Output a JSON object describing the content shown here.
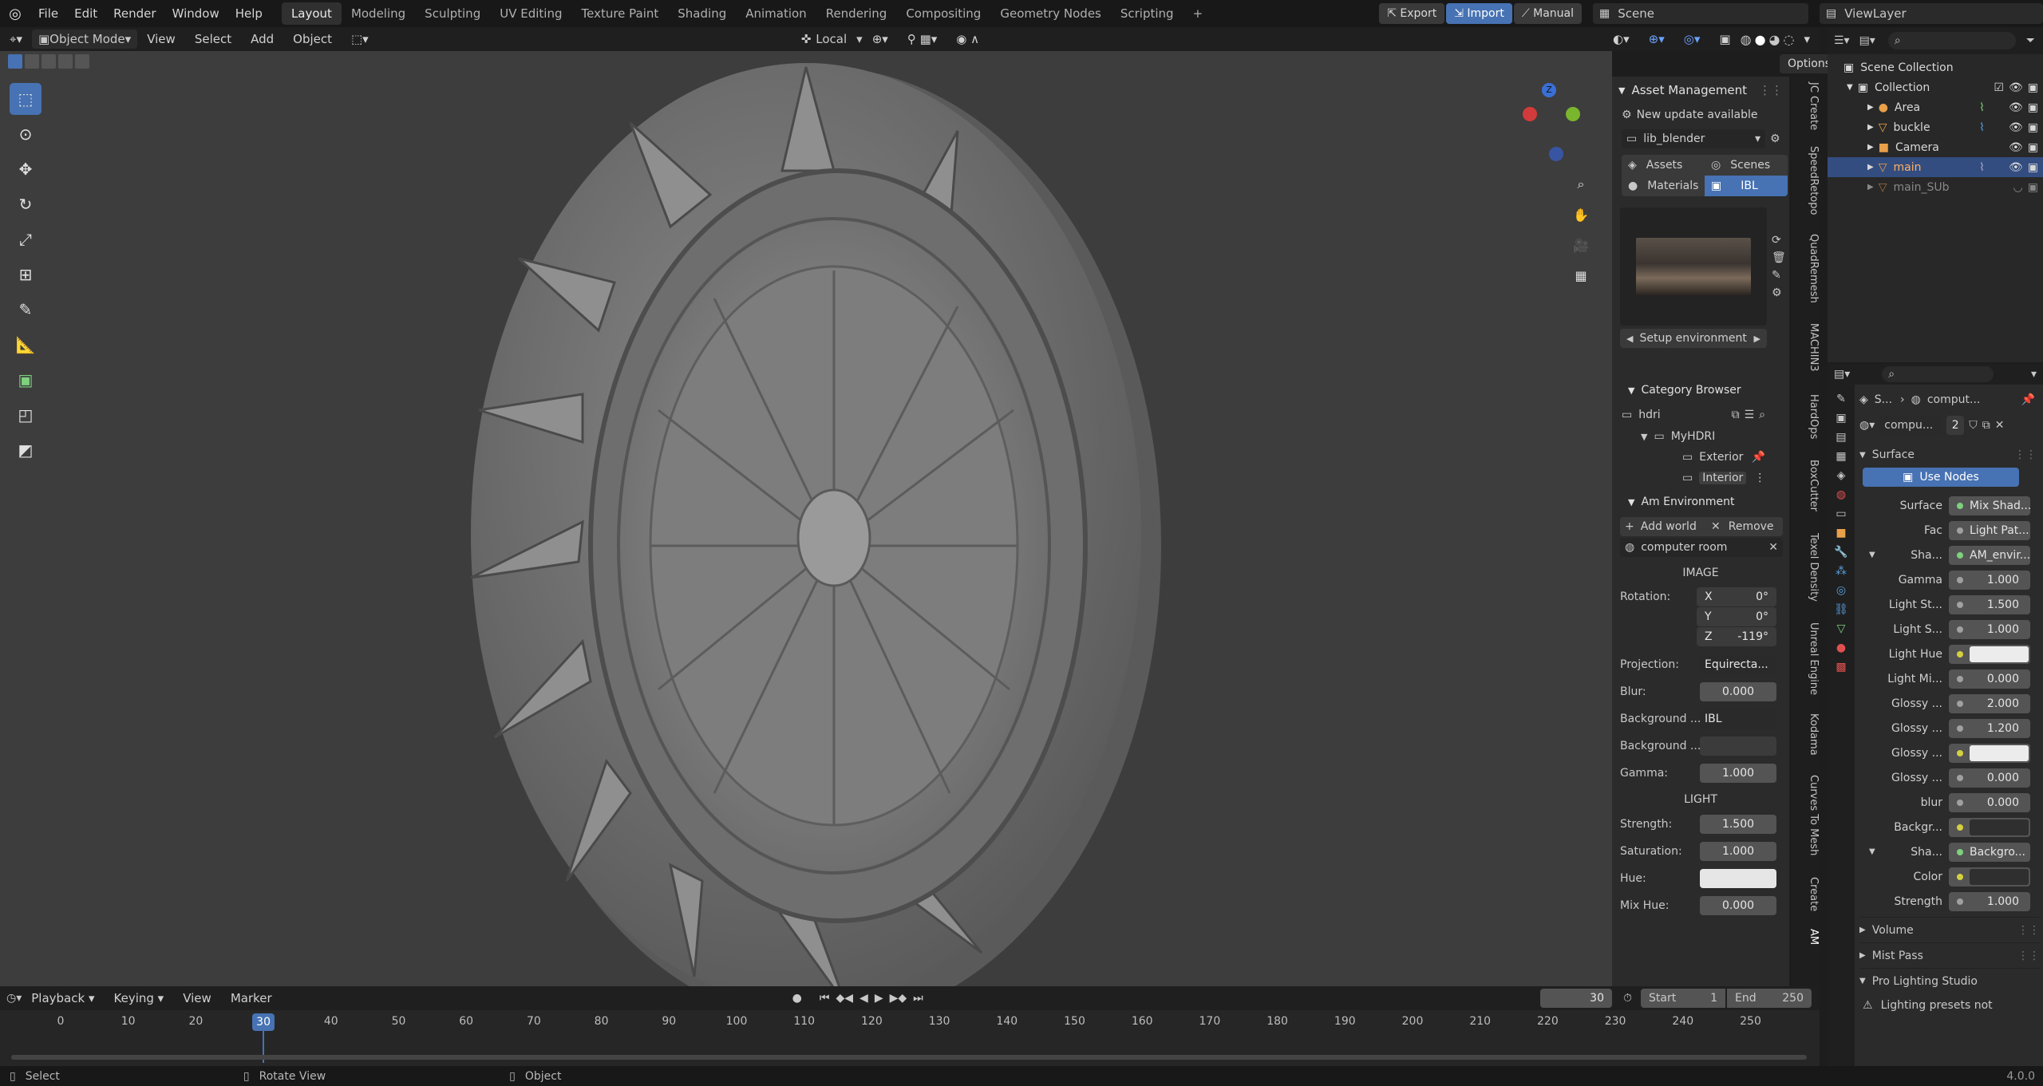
{
  "topbar": {
    "menus": [
      "File",
      "Edit",
      "Render",
      "Window",
      "Help"
    ],
    "workspaces": [
      "Layout",
      "Modeling",
      "Sculpting",
      "UV Editing",
      "Texture Paint",
      "Shading",
      "Animation",
      "Rendering",
      "Compositing",
      "Geometry Nodes",
      "Scripting"
    ],
    "active_workspace": "Layout",
    "add_tab": "+",
    "export": "Export",
    "import": "Import",
    "manual": "Manual",
    "scene": "Scene",
    "view_layer": "ViewLayer"
  },
  "vp_header": {
    "mode": "Object Mode",
    "menus": [
      "View",
      "Select",
      "Add",
      "Object"
    ],
    "orientation": "Local",
    "options": "Options"
  },
  "npanel": {
    "asset_mgmt_title": "Asset Management",
    "update_notice": "New update available",
    "library": "lib_blender",
    "tab_assets": "Assets",
    "tab_scenes": "Scenes",
    "tab_materials": "Materials",
    "tab_ibl": "IBL",
    "setup_env": "Setup environment",
    "category_title": "Category Browser",
    "cat_root": "hdri",
    "cat_folder": "MyHDRI",
    "cat_exterior": "Exterior",
    "cat_interior": "Interior",
    "env_title": "Am Environment",
    "add_world": "Add world",
    "remove": "Remove",
    "world_name": "computer room",
    "image_header": "IMAGE",
    "rotation_label": "Rotation:",
    "rot_x_label": "X",
    "rot_x": "0°",
    "rot_y_label": "Y",
    "rot_y": "0°",
    "rot_z_label": "Z",
    "rot_z": "-119°",
    "projection_label": "Projection:",
    "projection": "Equirecta...",
    "blur_label": "Blur:",
    "blur": "0.000",
    "bg_label": "Background ...",
    "bg_value": "IBL",
    "bg2_label": "Background ...",
    "gamma_label": "Gamma:",
    "gamma": "1.000",
    "light_header": "LIGHT",
    "strength_label": "Strength:",
    "strength": "1.500",
    "saturation_label": "Saturation:",
    "saturation": "1.000",
    "hue_label": "Hue:",
    "mixhue_label": "Mix Hue:",
    "mixhue": "0.000"
  },
  "vtabs": [
    "JC Create",
    "SpeedRetopo",
    "QuadRemesh",
    "MACHIN3",
    "HardOps",
    "BoxCutter",
    "Texel Density",
    "Unreal Engine",
    "Kodama",
    "Curves To Mesh",
    "Create",
    "AM"
  ],
  "outliner": {
    "root": "Scene Collection",
    "collection": "Collection",
    "items": [
      "Area",
      "buckle",
      "Camera",
      "main",
      "main_SUb"
    ],
    "selected": "main"
  },
  "props": {
    "world_short": "S...",
    "world_name": "comput...",
    "world_data": "compu...",
    "users": "2",
    "surface_section": "Surface",
    "use_nodes": "Use Nodes",
    "rows": [
      {
        "label": "Surface",
        "value": "Mix Shad..."
      },
      {
        "label": "Fac",
        "value": "Light Pat..."
      },
      {
        "label": "Sha...",
        "value": "AM_envir..."
      },
      {
        "label": "Gamma",
        "value": "1.000"
      },
      {
        "label": "Light St...",
        "value": "1.500"
      },
      {
        "label": "Light S...",
        "value": "1.000"
      },
      {
        "label": "Light Hue",
        "value": ""
      },
      {
        "label": "Light Mi...",
        "value": "0.000"
      },
      {
        "label": "Glossy ...",
        "value": "2.000"
      },
      {
        "label": "Glossy ...",
        "value": "1.200"
      },
      {
        "label": "Glossy ...",
        "value": ""
      },
      {
        "label": "Glossy ...",
        "value": "0.000"
      },
      {
        "label": "blur",
        "value": "0.000"
      },
      {
        "label": "Backgr...",
        "value": ""
      },
      {
        "label": "Sha...",
        "value": "Backgro..."
      },
      {
        "label": "Color",
        "value": ""
      },
      {
        "label": "Strength",
        "value": "1.000"
      }
    ],
    "volume": "Volume",
    "mist": "Mist Pass",
    "pro_lighting": "Pro Lighting Studio",
    "warning": "Lighting presets not"
  },
  "timeline": {
    "menus": [
      "Playback",
      "Keying",
      "View",
      "Marker"
    ],
    "current_frame": "30",
    "start_label": "Start",
    "start": "1",
    "end_label": "End",
    "end": "250",
    "ticks": [
      "0",
      "10",
      "20",
      "30",
      "40",
      "50",
      "60",
      "70",
      "80",
      "90",
      "100",
      "110",
      "120",
      "130",
      "140",
      "150",
      "160",
      "170",
      "180",
      "190",
      "200",
      "210",
      "220",
      "230",
      "240",
      "250"
    ]
  },
  "status": {
    "select": "Select",
    "rotate": "Rotate View",
    "object": "Object",
    "version": "4.0.0"
  },
  "gizmo": {
    "z": "Z"
  }
}
